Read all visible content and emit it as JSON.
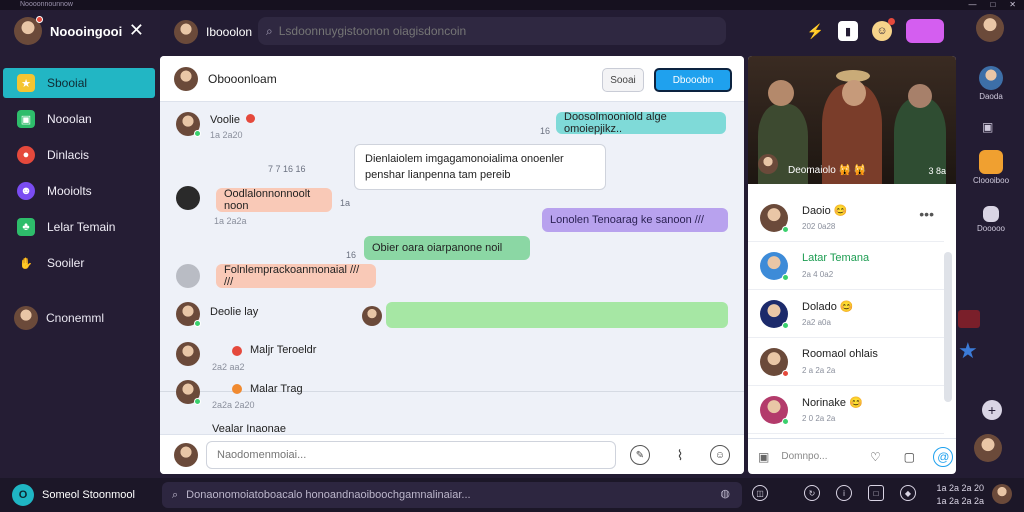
{
  "window": {
    "title": "Noooonnounnow",
    "controls": [
      "—",
      "□",
      "✕"
    ]
  },
  "sidebar": {
    "account_name": "Noooingooi",
    "close_icon": "✕",
    "items": [
      {
        "label": "Sbooial",
        "icon": "star-icon",
        "color": "#f4c531"
      },
      {
        "label": "Nooolan",
        "icon": "shop-icon",
        "color": "#2ebd6b"
      },
      {
        "label": "Dinlacis",
        "icon": "record-icon",
        "color": "#e5493c"
      },
      {
        "label": "Mooiolts",
        "icon": "people-icon",
        "color": "#7a4cf2"
      },
      {
        "label": "Lelar Temain",
        "icon": "leaf-icon",
        "color": "#2ebd6b"
      },
      {
        "label": "Sooiler",
        "icon": "hand-icon",
        "color": "#d9d4e4"
      }
    ],
    "user_label": "Cnonemml"
  },
  "header": {
    "user_name": "Ibooolon",
    "search_placeholder": "Lsdoonnuygistoonon oiagisdoncoin"
  },
  "chat": {
    "title": "Obooonloam",
    "btn_secondary": "Sooai",
    "btn_primary": "Dbooobn",
    "messages": [
      {
        "name": "Voolie",
        "time": "1a 2a20",
        "bubble": "Doosolmooniold alge omoiepjikz..",
        "bubble_meta": "16"
      },
      {
        "tiny": "7 7 16 16",
        "bubble": "Dienlaiolem imgagamonoialima onoenler penshar lianpenna tam pereib"
      },
      {
        "bubble": "Oodlalonnonnoolt noon",
        "bubble_meta": "1a",
        "time": "1a 2a2a"
      },
      {
        "bubble": "Lonolen Tenoarag ke sanoon ///",
        "tiny": "16"
      },
      {
        "bubble": "Obier oara oiarpanone noil",
        "tiny": "16"
      },
      {
        "bubble": "Folnlemprackoanmonaial /// ///"
      },
      {
        "name": "Deolie lay"
      }
    ],
    "lower": [
      {
        "name": "Maljr Teroeldr",
        "time": "2a2 aa2"
      },
      {
        "name": "Malar Trag",
        "time": "2a2a 2a20"
      },
      {
        "name": "Vealar Inaonae"
      }
    ],
    "composer_placeholder": "Naodomenmoiai..."
  },
  "right_panel": {
    "photo_caption": "Deomaiolo 🙀 🙀",
    "photo_count": "3 8a",
    "users": [
      {
        "name": "Daoio 😊",
        "time": "202 0a28"
      },
      {
        "name": "Latar Temana",
        "time": "2a 4 0a2",
        "highlight": true
      },
      {
        "name": "Dolado 😊",
        "time": "2a2 a0a"
      },
      {
        "name": "Roomaol ohlais",
        "time": "2 a 2a 2a"
      },
      {
        "name": "Norinake 😊",
        "time": "2 0 2a 2a"
      }
    ],
    "foot_placeholder": "Domnpo..."
  },
  "rail": {
    "items": [
      {
        "label": "Daoda"
      },
      {
        "label": "Cloooiboo"
      },
      {
        "label": "Dooooo"
      }
    ]
  },
  "bottombar": {
    "brand": "Someol Stoonmool",
    "search_text": "Donaonomoiatoboacalo honoandnaoiboochgamnalinaiar...",
    "clock_line1": "1a 2a 2a 20",
    "clock_line2": "1a 2a 2a 2a"
  }
}
